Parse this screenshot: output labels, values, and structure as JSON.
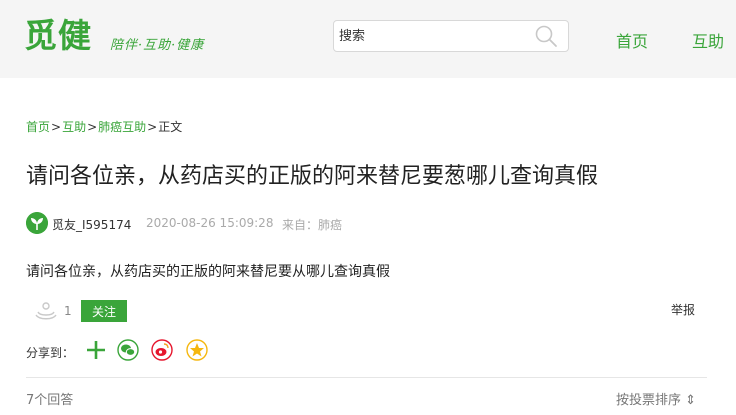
{
  "header": {
    "logo": "觅健",
    "slogan": "陪伴·互助·健康",
    "search_placeholder": "搜索",
    "nav": [
      "首页",
      "互助"
    ]
  },
  "breadcrumb": {
    "items": [
      "首页",
      "互助",
      "肺癌互助"
    ],
    "current": "正文",
    "separator": ">"
  },
  "post": {
    "title": "请问各位亲，从药店买的正版的阿来替尼要葱哪儿查询真假",
    "author": "觅友_I595174",
    "time": "2020-08-26 15:09:28",
    "source": "来自：肺癌",
    "body": "请问各位亲，从药店买的正版的阿来替尼要从哪儿查询真假",
    "like_count": "1",
    "follow_label": "关注",
    "report_label": "举报"
  },
  "share": {
    "label": "分享到：",
    "icons": [
      "plus-icon",
      "wechat-icon",
      "weibo-icon",
      "qzone-icon"
    ]
  },
  "answers": {
    "count_label": "7个回答",
    "sort_label": "按投票排序 ⇕"
  },
  "colors": {
    "brand_green": "#3aa53a",
    "header_bg": "#f5f5f5",
    "weibo_red": "#e6162d",
    "qzone_yellow": "#f5b70f"
  }
}
